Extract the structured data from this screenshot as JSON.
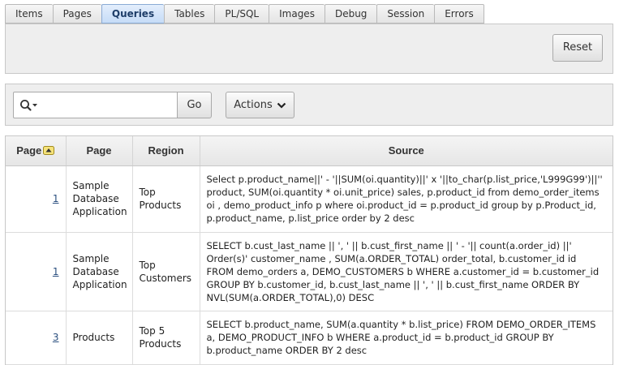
{
  "tabs": [
    {
      "label": "Items",
      "active": false
    },
    {
      "label": "Pages",
      "active": false
    },
    {
      "label": "Queries",
      "active": true
    },
    {
      "label": "Tables",
      "active": false
    },
    {
      "label": "PL/SQL",
      "active": false
    },
    {
      "label": "Images",
      "active": false
    },
    {
      "label": "Debug",
      "active": false
    },
    {
      "label": "Session",
      "active": false
    },
    {
      "label": "Errors",
      "active": false
    }
  ],
  "toolbar": {
    "reset_label": "Reset"
  },
  "search": {
    "value": "",
    "go_label": "Go",
    "actions_label": "Actions"
  },
  "table": {
    "headers": {
      "page_num": "Page",
      "page": "Page",
      "region": "Region",
      "source": "Source"
    },
    "rows": [
      {
        "page_num": "1",
        "page": "Sample Database Application",
        "region": "Top Products",
        "source": "Select p.product_name||' - '||SUM(oi.quantity)||' x '||to_char(p.list_price,'L999G99')||'' product, SUM(oi.quantity * oi.unit_price) sales, p.product_id from demo_order_items oi , demo_product_info p where oi.product_id = p.product_id group by p.Product_id, p.product_name, p.list_price order by 2 desc"
      },
      {
        "page_num": "1",
        "page": "Sample Database Application",
        "region": "Top Customers",
        "source": "SELECT b.cust_last_name || ', ' || b.cust_first_name || ' - '|| count(a.order_id) ||' Order(s)' customer_name , SUM(a.ORDER_TOTAL) order_total, b.customer_id id FROM demo_orders a, DEMO_CUSTOMERS b WHERE a.customer_id = b.customer_id GROUP BY b.customer_id, b.cust_last_name || ', ' || b.cust_first_name ORDER BY NVL(SUM(a.ORDER_TOTAL),0) DESC"
      },
      {
        "page_num": "3",
        "page": "Products",
        "region": "Top 5 Products",
        "source": "SELECT b.product_name, SUM(a.quantity * b.list_price) FROM DEMO_ORDER_ITEMS a, DEMO_PRODUCT_INFO b WHERE a.product_id = b.product_id GROUP BY b.product_name ORDER BY 2 desc"
      }
    ]
  }
}
